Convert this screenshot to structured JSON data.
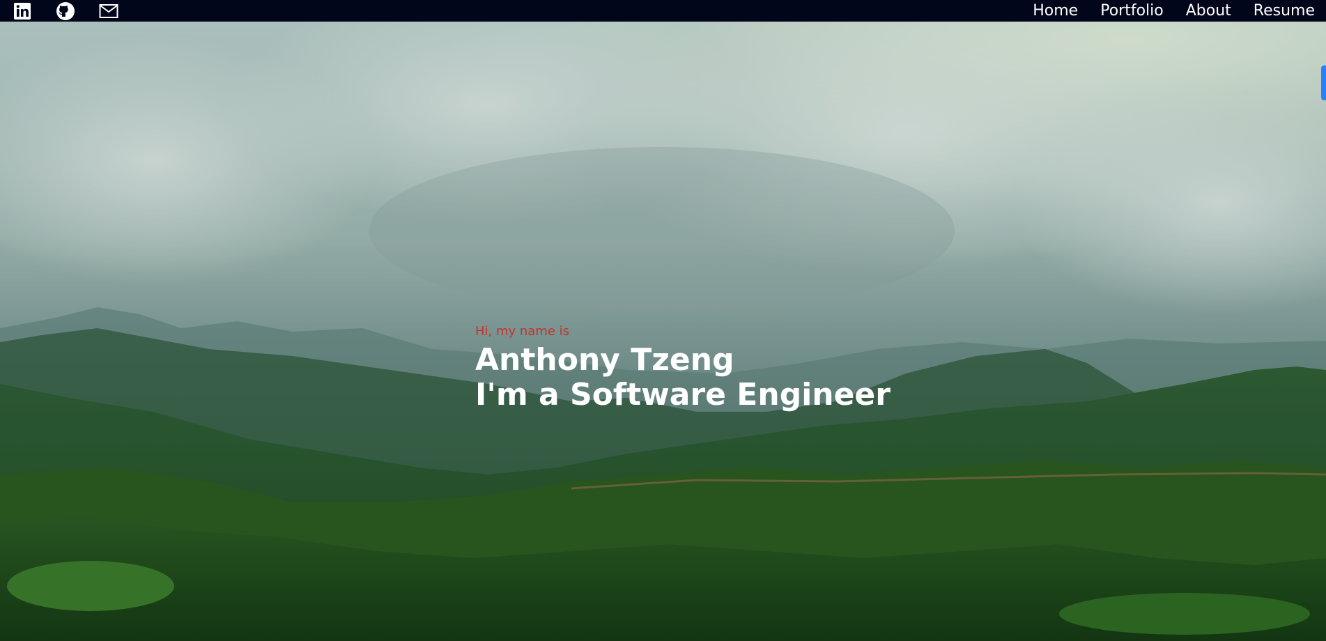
{
  "nav": {
    "social": [
      {
        "icon": "linkedin-icon",
        "label": "LinkedIn"
      },
      {
        "icon": "github-icon",
        "label": "GitHub"
      },
      {
        "icon": "mail-icon",
        "label": "Email"
      }
    ],
    "links": [
      "Home",
      "Portfolio",
      "About",
      "Resume"
    ]
  },
  "hero": {
    "greeting": "Hi, my name is",
    "name": "Anthony Tzeng",
    "role": "I'm a Software Engineer",
    "background": "cloudy-mountain-landscape"
  },
  "colors": {
    "navbar_bg": "#02061a",
    "greeting": "#c8312d",
    "heading": "#ffffff",
    "scroll_accent": "#2a7fff"
  }
}
